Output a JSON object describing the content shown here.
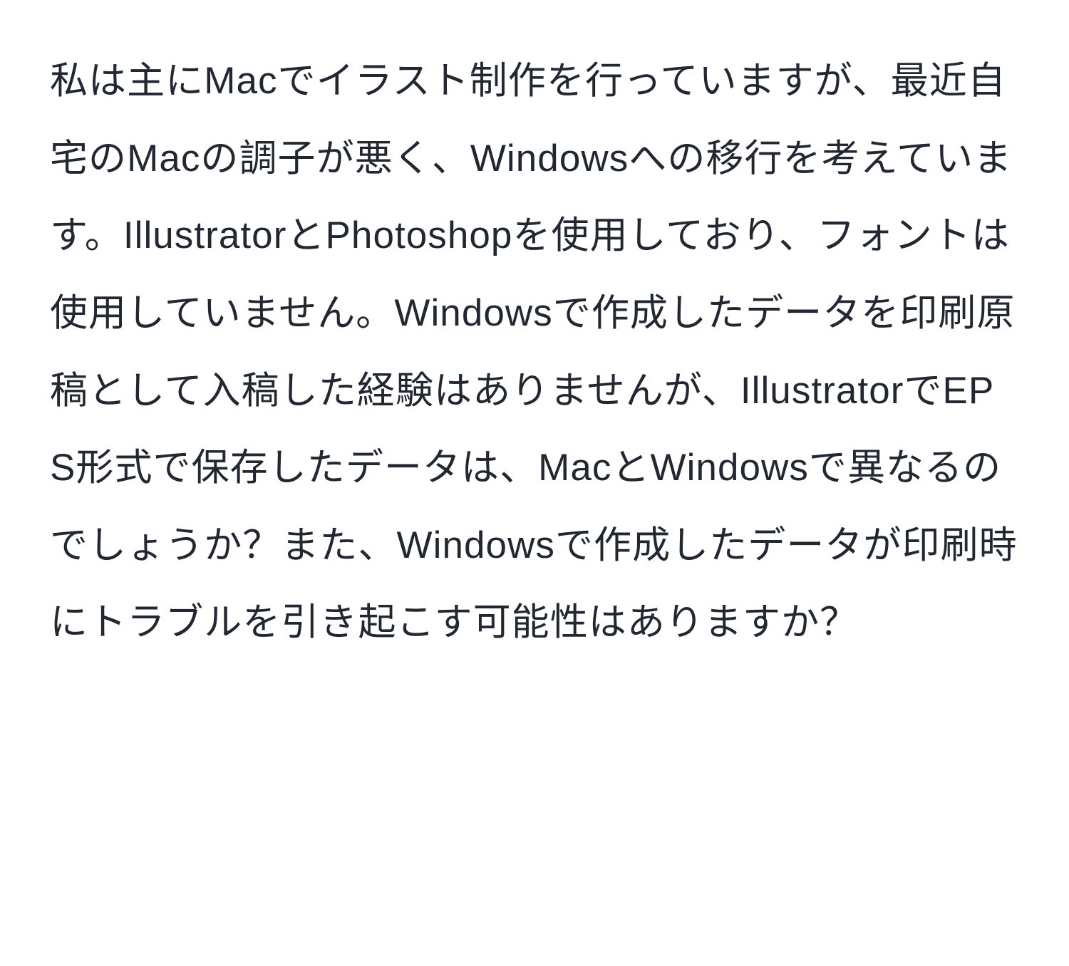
{
  "document": {
    "paragraph": "私は主にMacでイラスト制作を行っていますが、最近自宅のMacの調子が悪く、Windowsへの移行を考えています。IllustratorとPhotoshopを使用しており、フォントは使用していません。Windowsで作成したデータを印刷原稿として入稿した経験はありませんが、IllustratorでEPS形式で保存したデータは、MacとWindowsで異なるのでしょうか？また、Windowsで作成したデータが印刷時にトラブルを引き起こす可能性はありますか？"
  }
}
